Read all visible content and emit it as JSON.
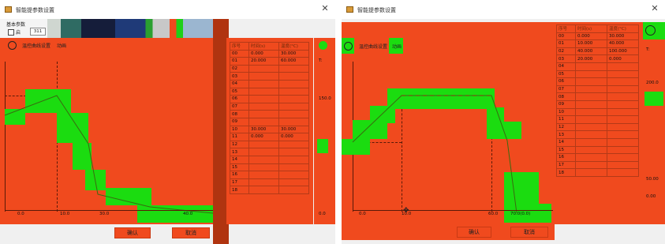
{
  "left": {
    "title": "智能提参数设置",
    "basic_params": "基本参数",
    "checkbox_label": "启",
    "field_value": "311",
    "chart_tab": "温控曲线设置",
    "chart_tab_extra": "动画",
    "x_ticks": [
      "0.0",
      "10.0",
      "30.0",
      "40.0"
    ],
    "table_headers": [
      "序号",
      "时间(s)",
      "温度(°C)"
    ],
    "rows": [
      [
        "00",
        "0.000",
        "30.000"
      ],
      [
        "01",
        "20.000",
        "60.000"
      ],
      [
        "02",
        "",
        ""
      ],
      [
        "03",
        "",
        ""
      ],
      [
        "04",
        "",
        ""
      ],
      [
        "05",
        "",
        ""
      ],
      [
        "06",
        "",
        ""
      ],
      [
        "07",
        "",
        ""
      ],
      [
        "08",
        "",
        ""
      ],
      [
        "09",
        "",
        ""
      ],
      [
        "10",
        "30.000",
        "30.000"
      ],
      [
        "11",
        "0.000",
        "0.000"
      ],
      [
        "12",
        "",
        ""
      ],
      [
        "13",
        "",
        ""
      ],
      [
        "14",
        "",
        ""
      ],
      [
        "15",
        "",
        ""
      ],
      [
        "16",
        "",
        ""
      ],
      [
        "17",
        "",
        ""
      ],
      [
        "18",
        "",
        ""
      ]
    ],
    "side_label_top": "T:",
    "side_value_top": "150.0",
    "side_value_bottom": "0.0",
    "confirm_label": "确认",
    "cancel_label": "取消"
  },
  "right": {
    "title": "智能提参数设置",
    "chart_tab": "温控曲线设置",
    "chart_tab_extra": "动画",
    "x_ticks": [
      "0.0",
      "10.0",
      "60.0",
      "70.0(0.0)"
    ],
    "table_headers": [
      "序号",
      "时间(s)",
      "温度(°C)"
    ],
    "rows": [
      [
        "00",
        "0.000",
        "30.000"
      ],
      [
        "01",
        "10.000",
        "40.000"
      ],
      [
        "02",
        "40.000",
        "100.000"
      ],
      [
        "03",
        "20.000",
        "0.000"
      ],
      [
        "04",
        "",
        ""
      ],
      [
        "05",
        "",
        ""
      ],
      [
        "06",
        "",
        ""
      ],
      [
        "07",
        "",
        ""
      ],
      [
        "08",
        "",
        ""
      ],
      [
        "09",
        "",
        ""
      ],
      [
        "10",
        "",
        ""
      ],
      [
        "11",
        "",
        ""
      ],
      [
        "12",
        "",
        ""
      ],
      [
        "13",
        "",
        ""
      ],
      [
        "14",
        "",
        ""
      ],
      [
        "15",
        "",
        ""
      ],
      [
        "16",
        "",
        ""
      ],
      [
        "17",
        "",
        ""
      ],
      [
        "18",
        "",
        ""
      ]
    ],
    "side_label_top": "T:",
    "side_value_top": "200.0",
    "side_value_mid": "50.00",
    "side_value_bottom": "0.00",
    "confirm_label": "确认",
    "cancel_label": "取消"
  },
  "colors": {
    "fill_red": "#f04a1e",
    "curve_green": "#1bdc10",
    "line_dark": "#3a6a10"
  }
}
